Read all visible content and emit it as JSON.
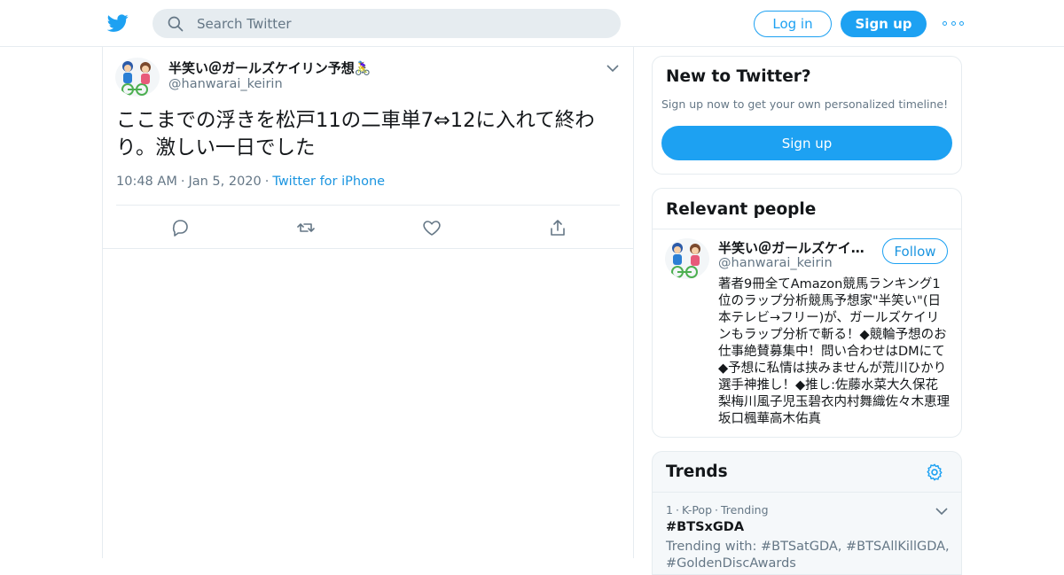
{
  "topbar": {
    "logo_icon": "twitter-bird-icon",
    "search_placeholder": "Search Twitter",
    "login_label": "Log in",
    "signup_label": "Sign up",
    "more_icon": "more-dots-icon"
  },
  "tweet": {
    "author_name": "半笑い＠ガールズケイリン予想🚴‍♀️",
    "author_handle": "@hanwarai_keirin",
    "text": "ここまでの浮きを松戸11の二車単7⇔12に入れて終わり。激しい一日でした",
    "time": "10:48 AM",
    "date": "Jan 5, 2020",
    "source": "Twitter for iPhone",
    "separator": "·",
    "actions": [
      "reply-icon",
      "retweet-icon",
      "like-icon",
      "share-icon"
    ]
  },
  "new_to_twitter": {
    "title": "New to Twitter?",
    "subtitle": "Sign up now to get your own personalized timeline!",
    "signup_label": "Sign up"
  },
  "relevant_people": {
    "title": "Relevant people",
    "name": "半笑い＠ガールズケイリン予想🚴‍♀️",
    "handle": "@hanwarai_keirin",
    "follow_label": "Follow",
    "bio": "著者9冊全てAmazon競馬ランキング1位のラップ分析競馬予想家\"半笑い\"(日本テレビ→フリー)が、ガールズケイリンもラップ分析で斬る！◆競輪予想のお仕事絶賛募集中！問い合わせはDMにて◆予想に私情は挟みませんが荒川ひかり選手神推し！◆推し:佐藤水菜大久保花梨梅川風子児玉碧衣内村舞織佐々木恵理坂口楓華高木佑真"
  },
  "trends": {
    "title": "Trends",
    "item": {
      "rank": "1",
      "category": "K-Pop",
      "status": "Trending",
      "separator": "·",
      "tag": "#BTSxGDA",
      "with": "Trending with: #BTSatGDA, #BTSAllKillGDA, #GoldenDiscAwards"
    }
  },
  "colors": {
    "accent": "#1da1f2",
    "link": "#1b95e0",
    "text": "#14171a",
    "muted": "#657786",
    "border": "#e6ecf0"
  }
}
